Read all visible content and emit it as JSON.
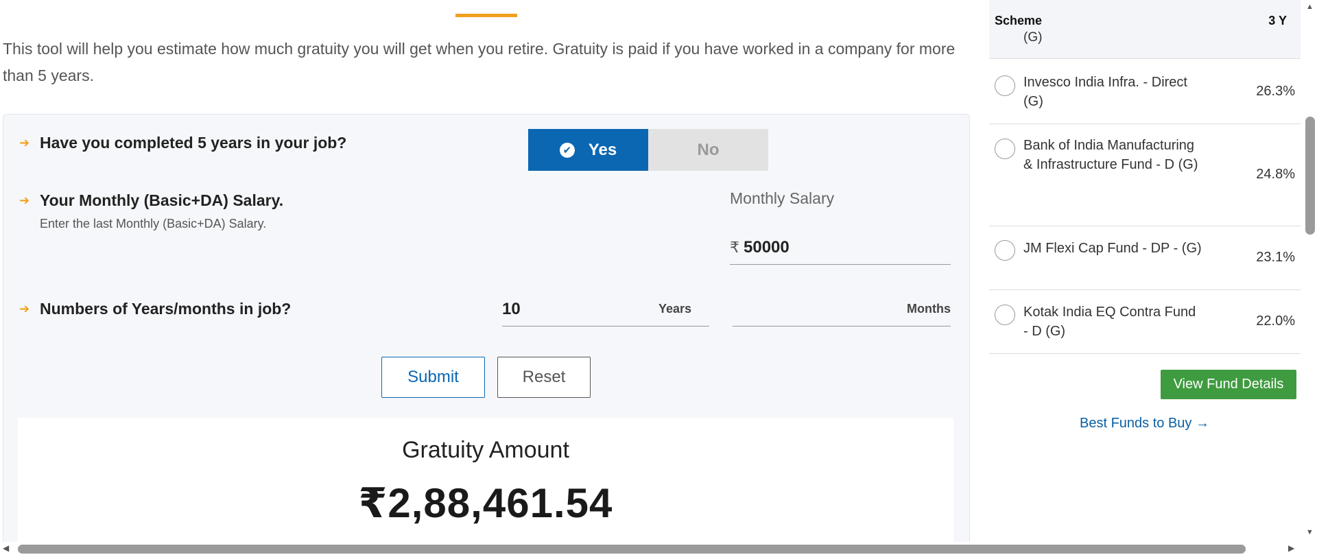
{
  "intro": "This tool will help you estimate how much gratuity you will get when you retire. Gratuity is paid if you have worked in a company for more than 5 years.",
  "questions": {
    "q1": "Have you completed 5 years in your job?",
    "q2": "Your Monthly (Basic+DA) Salary.",
    "q2_sub": "Enter the last Monthly (Basic+DA) Salary.",
    "q3": "Numbers of Years/months in job?"
  },
  "toggle": {
    "yes": "Yes",
    "no": "No",
    "selected": "Yes",
    "active_color": "#0b67b2"
  },
  "salary": {
    "label": "Monthly Salary",
    "currency": "₹",
    "value": "50000"
  },
  "tenure": {
    "years_value": "10",
    "years_unit": "Years",
    "months_value": "",
    "months_unit": "Months"
  },
  "buttons": {
    "submit": "Submit",
    "reset": "Reset"
  },
  "result": {
    "label": "Gratuity Amount",
    "amount": "₹2,88,461.54"
  },
  "sidebar": {
    "header": {
      "scheme": "Scheme",
      "return": "3 Y",
      "cut_text": "(G)"
    },
    "funds": [
      {
        "name": "Invesco India Infra. - Direct (G)",
        "return": "26.3%"
      },
      {
        "name": "Bank of India Manufacturing & Infrastructure Fund - D (G)",
        "return": "24.8%"
      },
      {
        "name": "JM Flexi Cap Fund - DP - (G)",
        "return": "23.1%"
      },
      {
        "name": "Kotak India EQ Contra Fund - D (G)",
        "return": "22.0%"
      }
    ],
    "view_button": "View Fund Details",
    "best_link": "Best Funds to Buy →",
    "button_color": "#3f9b3f"
  },
  "colors": {
    "accent": "#f0a01e",
    "primary": "#0b67b2"
  }
}
